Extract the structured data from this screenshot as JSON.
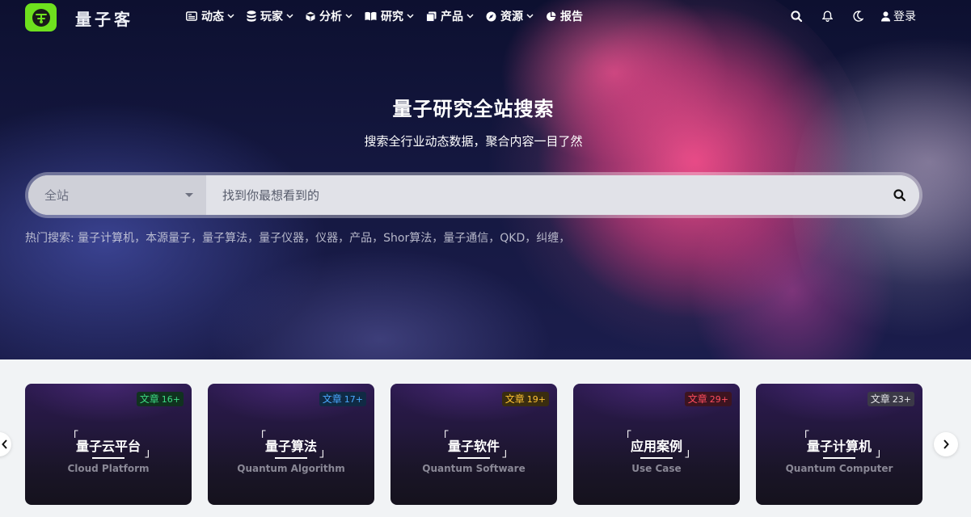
{
  "brand": {
    "name": "量子客",
    "logo_color": "#6ee01e",
    "logo_icon": "quantum-logo-icon"
  },
  "nav": {
    "items": [
      {
        "label": "动态",
        "icon": "newspaper-icon",
        "has_dropdown": true
      },
      {
        "label": "玩家",
        "icon": "database-icon",
        "has_dropdown": true
      },
      {
        "label": "分析",
        "icon": "cube-icon",
        "has_dropdown": true
      },
      {
        "label": "研究",
        "icon": "book-open-icon",
        "has_dropdown": true
      },
      {
        "label": "产品",
        "icon": "copy-icon",
        "has_dropdown": true
      },
      {
        "label": "资源",
        "icon": "compass-icon",
        "has_dropdown": true
      },
      {
        "label": "报告",
        "icon": "pie-chart-icon",
        "has_dropdown": false
      }
    ],
    "right_icons": [
      "search-icon",
      "bell-icon",
      "moon-icon"
    ],
    "login_label": "登录"
  },
  "hero": {
    "title": "量子研究全站搜索",
    "subtitle": "搜索全行业动态数据，聚合内容一目了然",
    "search": {
      "scope_value": "全站",
      "placeholder": "找到你最想看到的"
    },
    "hot_label": "热门搜索:",
    "hot_terms": [
      "量子计算机，",
      "本源量子，",
      "量子算法，",
      "量子仪器，",
      "仪器，",
      "产品，",
      "Shor算法，",
      "量子通信，",
      "QKD，",
      "纠缠，"
    ]
  },
  "categories": [
    {
      "title": "量子云平台",
      "subtitle": "Cloud Platform",
      "badge_label": "文章",
      "badge_count": "16+",
      "badge_color": "#3ddc84",
      "badge_bg": "#10321f"
    },
    {
      "title": "量子算法",
      "subtitle": "Quantum Algorithm",
      "badge_label": "文章",
      "badge_count": "17+",
      "badge_color": "#4aa8ff",
      "badge_bg": "#102a44"
    },
    {
      "title": "量子软件",
      "subtitle": "Quantum Software",
      "badge_label": "文章",
      "badge_count": "19+",
      "badge_color": "#ffc233",
      "badge_bg": "#3a2d10"
    },
    {
      "title": "应用案例",
      "subtitle": "Use Case",
      "badge_label": "文章",
      "badge_count": "29+",
      "badge_color": "#ff4d5e",
      "badge_bg": "#3d1420"
    },
    {
      "title": "量子计算机",
      "subtitle": "Quantum Computer",
      "badge_label": "文章",
      "badge_count": "23+",
      "badge_color": "#e6e6ea",
      "badge_bg": "#3b3947"
    }
  ]
}
